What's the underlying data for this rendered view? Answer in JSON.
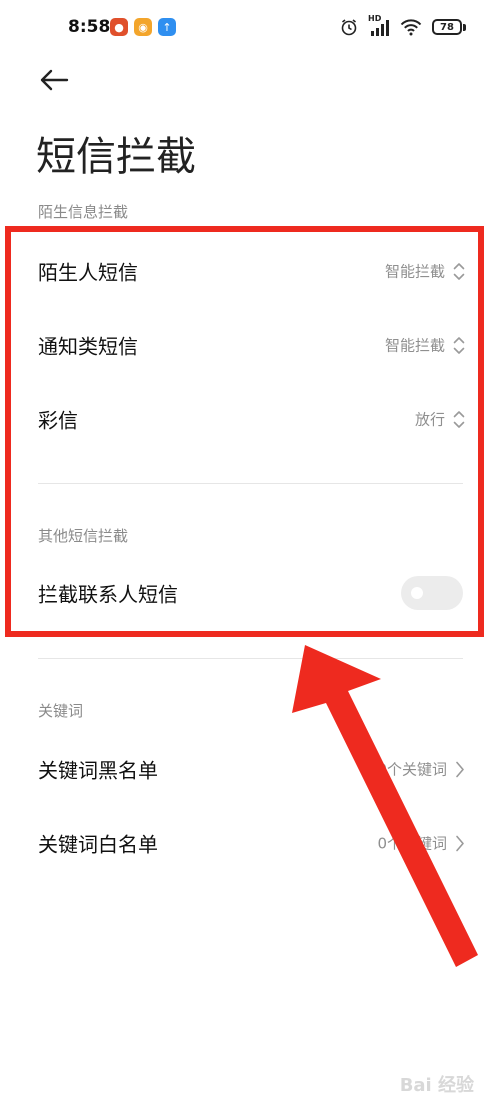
{
  "status_bar": {
    "time": "8:58",
    "hd_label": "HD",
    "battery": "78"
  },
  "header": {
    "back_icon": "arrow-left-icon",
    "title": "短信拦截"
  },
  "stranger_section": {
    "title": "陌生信息拦截",
    "items": [
      {
        "label": "陌生人短信",
        "value": "智能拦截"
      },
      {
        "label": "通知类短信",
        "value": "智能拦截"
      },
      {
        "label": "彩信",
        "value": "放行"
      }
    ]
  },
  "other_section": {
    "title": "其他短信拦截",
    "contact_sms": {
      "label": "拦截联系人短信",
      "enabled": false
    }
  },
  "keyword_section": {
    "title": "关键词",
    "items": [
      {
        "label": "关键词黑名单",
        "value": "0个关键词"
      },
      {
        "label": "关键词白名单",
        "value": "0个关键词"
      }
    ]
  },
  "colors": {
    "highlight": "#ee2a1f",
    "secondary_text": "#8f8f8f"
  },
  "watermark": "Bai 经验"
}
